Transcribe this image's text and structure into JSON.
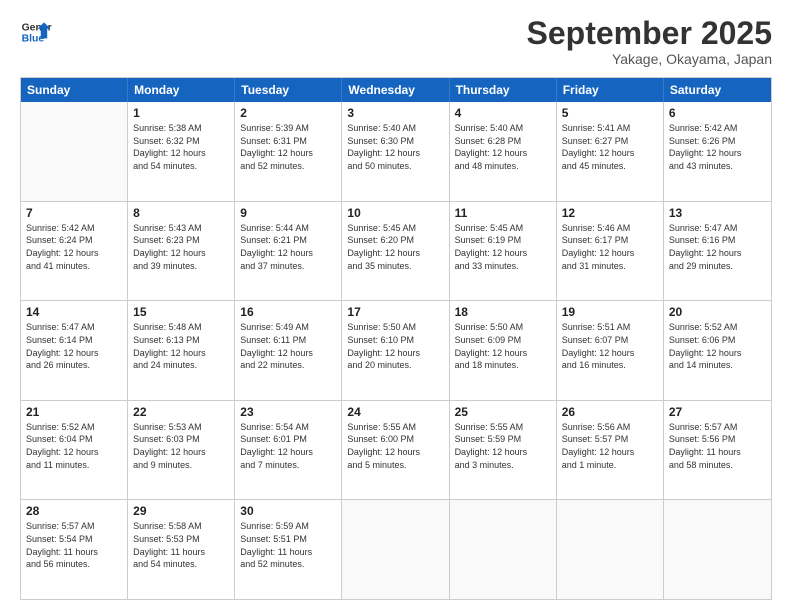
{
  "header": {
    "logo_line1": "General",
    "logo_line2": "Blue",
    "month": "September 2025",
    "location": "Yakage, Okayama, Japan"
  },
  "weekdays": [
    "Sunday",
    "Monday",
    "Tuesday",
    "Wednesday",
    "Thursday",
    "Friday",
    "Saturday"
  ],
  "rows": [
    [
      {
        "day": "",
        "info": ""
      },
      {
        "day": "1",
        "info": "Sunrise: 5:38 AM\nSunset: 6:32 PM\nDaylight: 12 hours\nand 54 minutes."
      },
      {
        "day": "2",
        "info": "Sunrise: 5:39 AM\nSunset: 6:31 PM\nDaylight: 12 hours\nand 52 minutes."
      },
      {
        "day": "3",
        "info": "Sunrise: 5:40 AM\nSunset: 6:30 PM\nDaylight: 12 hours\nand 50 minutes."
      },
      {
        "day": "4",
        "info": "Sunrise: 5:40 AM\nSunset: 6:28 PM\nDaylight: 12 hours\nand 48 minutes."
      },
      {
        "day": "5",
        "info": "Sunrise: 5:41 AM\nSunset: 6:27 PM\nDaylight: 12 hours\nand 45 minutes."
      },
      {
        "day": "6",
        "info": "Sunrise: 5:42 AM\nSunset: 6:26 PM\nDaylight: 12 hours\nand 43 minutes."
      }
    ],
    [
      {
        "day": "7",
        "info": "Sunrise: 5:42 AM\nSunset: 6:24 PM\nDaylight: 12 hours\nand 41 minutes."
      },
      {
        "day": "8",
        "info": "Sunrise: 5:43 AM\nSunset: 6:23 PM\nDaylight: 12 hours\nand 39 minutes."
      },
      {
        "day": "9",
        "info": "Sunrise: 5:44 AM\nSunset: 6:21 PM\nDaylight: 12 hours\nand 37 minutes."
      },
      {
        "day": "10",
        "info": "Sunrise: 5:45 AM\nSunset: 6:20 PM\nDaylight: 12 hours\nand 35 minutes."
      },
      {
        "day": "11",
        "info": "Sunrise: 5:45 AM\nSunset: 6:19 PM\nDaylight: 12 hours\nand 33 minutes."
      },
      {
        "day": "12",
        "info": "Sunrise: 5:46 AM\nSunset: 6:17 PM\nDaylight: 12 hours\nand 31 minutes."
      },
      {
        "day": "13",
        "info": "Sunrise: 5:47 AM\nSunset: 6:16 PM\nDaylight: 12 hours\nand 29 minutes."
      }
    ],
    [
      {
        "day": "14",
        "info": "Sunrise: 5:47 AM\nSunset: 6:14 PM\nDaylight: 12 hours\nand 26 minutes."
      },
      {
        "day": "15",
        "info": "Sunrise: 5:48 AM\nSunset: 6:13 PM\nDaylight: 12 hours\nand 24 minutes."
      },
      {
        "day": "16",
        "info": "Sunrise: 5:49 AM\nSunset: 6:11 PM\nDaylight: 12 hours\nand 22 minutes."
      },
      {
        "day": "17",
        "info": "Sunrise: 5:50 AM\nSunset: 6:10 PM\nDaylight: 12 hours\nand 20 minutes."
      },
      {
        "day": "18",
        "info": "Sunrise: 5:50 AM\nSunset: 6:09 PM\nDaylight: 12 hours\nand 18 minutes."
      },
      {
        "day": "19",
        "info": "Sunrise: 5:51 AM\nSunset: 6:07 PM\nDaylight: 12 hours\nand 16 minutes."
      },
      {
        "day": "20",
        "info": "Sunrise: 5:52 AM\nSunset: 6:06 PM\nDaylight: 12 hours\nand 14 minutes."
      }
    ],
    [
      {
        "day": "21",
        "info": "Sunrise: 5:52 AM\nSunset: 6:04 PM\nDaylight: 12 hours\nand 11 minutes."
      },
      {
        "day": "22",
        "info": "Sunrise: 5:53 AM\nSunset: 6:03 PM\nDaylight: 12 hours\nand 9 minutes."
      },
      {
        "day": "23",
        "info": "Sunrise: 5:54 AM\nSunset: 6:01 PM\nDaylight: 12 hours\nand 7 minutes."
      },
      {
        "day": "24",
        "info": "Sunrise: 5:55 AM\nSunset: 6:00 PM\nDaylight: 12 hours\nand 5 minutes."
      },
      {
        "day": "25",
        "info": "Sunrise: 5:55 AM\nSunset: 5:59 PM\nDaylight: 12 hours\nand 3 minutes."
      },
      {
        "day": "26",
        "info": "Sunrise: 5:56 AM\nSunset: 5:57 PM\nDaylight: 12 hours\nand 1 minute."
      },
      {
        "day": "27",
        "info": "Sunrise: 5:57 AM\nSunset: 5:56 PM\nDaylight: 11 hours\nand 58 minutes."
      }
    ],
    [
      {
        "day": "28",
        "info": "Sunrise: 5:57 AM\nSunset: 5:54 PM\nDaylight: 11 hours\nand 56 minutes."
      },
      {
        "day": "29",
        "info": "Sunrise: 5:58 AM\nSunset: 5:53 PM\nDaylight: 11 hours\nand 54 minutes."
      },
      {
        "day": "30",
        "info": "Sunrise: 5:59 AM\nSunset: 5:51 PM\nDaylight: 11 hours\nand 52 minutes."
      },
      {
        "day": "",
        "info": ""
      },
      {
        "day": "",
        "info": ""
      },
      {
        "day": "",
        "info": ""
      },
      {
        "day": "",
        "info": ""
      }
    ]
  ]
}
